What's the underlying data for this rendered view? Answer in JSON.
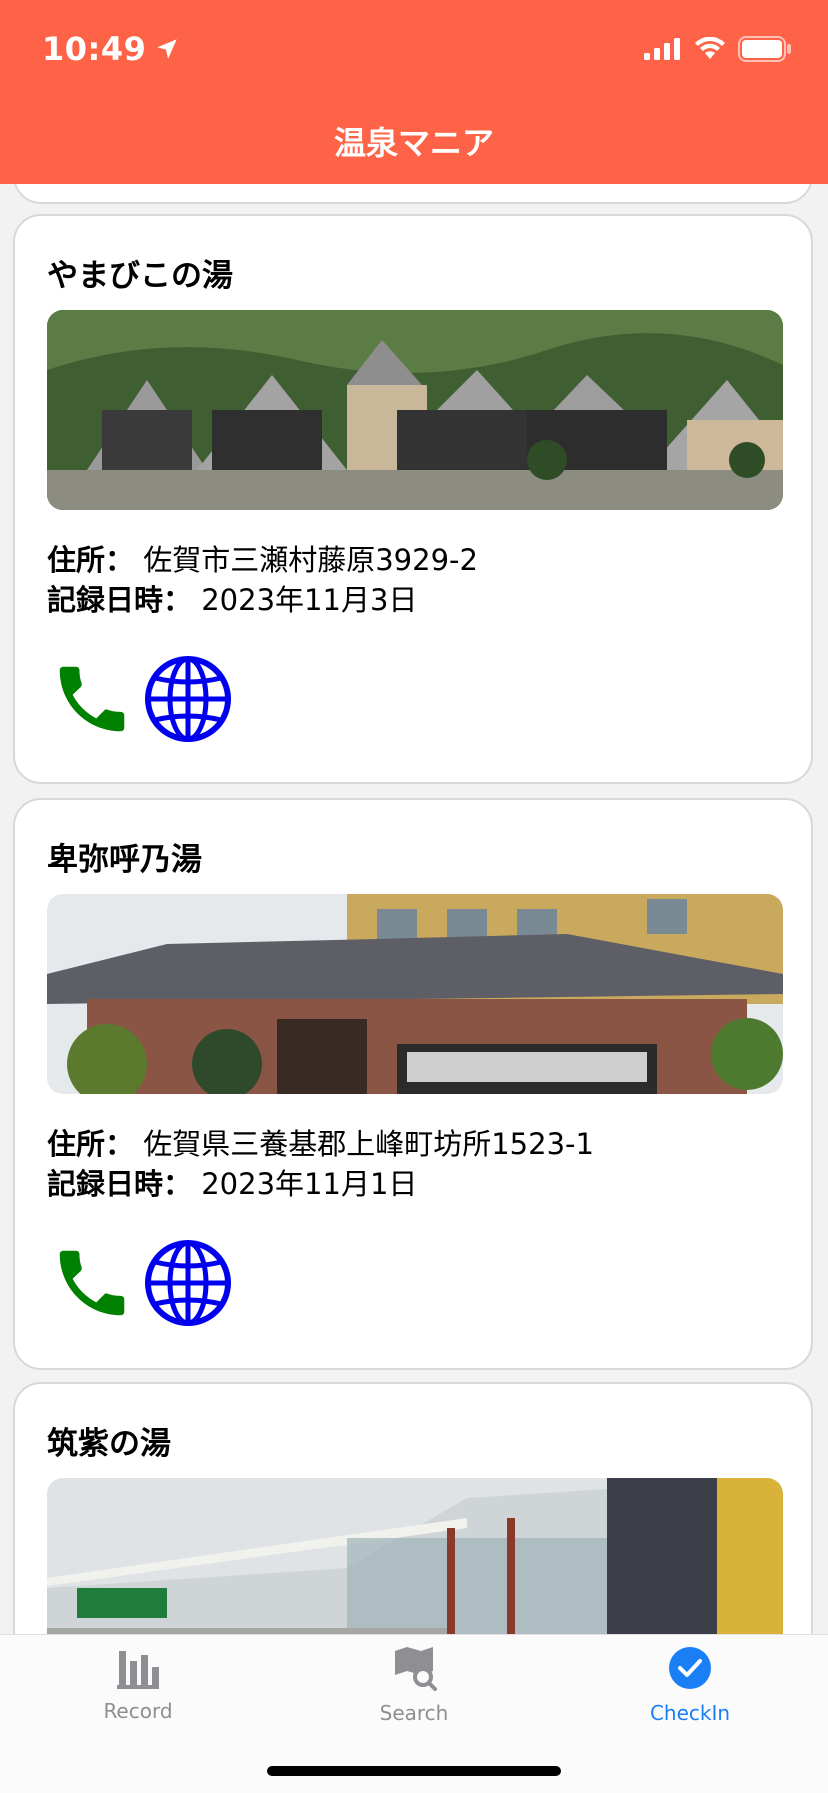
{
  "status": {
    "time": "10:49"
  },
  "nav": {
    "title": "温泉マニア"
  },
  "labels": {
    "address": "住所：",
    "date": "記録日時："
  },
  "cards": [
    {
      "name": "やまびこの湯",
      "address": "佐賀市三瀬村藤原3929-2",
      "date": "2023年11月3日"
    },
    {
      "name": "卑弥呼乃湯",
      "address": "佐賀県三養基郡上峰町坊所1523-1",
      "date": "2023年11月1日"
    },
    {
      "name": "筑紫の湯"
    }
  ],
  "tabs": [
    {
      "label": "Record",
      "icon": "chart-bar-icon"
    },
    {
      "label": "Search",
      "icon": "map-search-icon"
    },
    {
      "label": "CheckIn",
      "icon": "checkmark-circle-icon"
    }
  ],
  "colors": {
    "header": "#ff6347",
    "phone_icon": "#008000",
    "web_icon": "#0000ee",
    "tab_active": "#1a7ef5",
    "tab_inactive": "#8e8e93"
  }
}
